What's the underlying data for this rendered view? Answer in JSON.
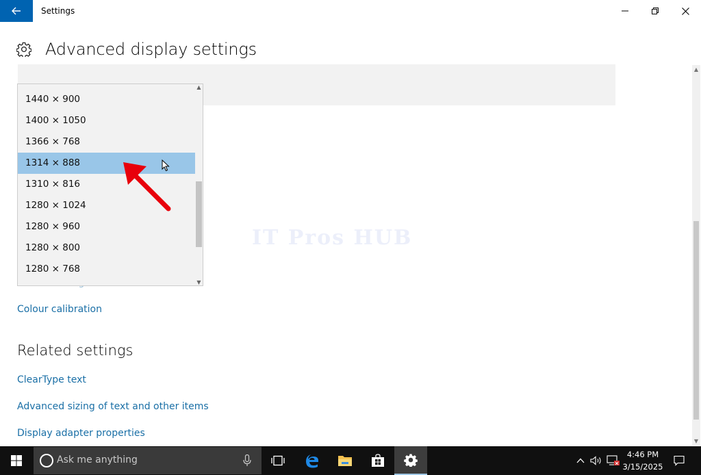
{
  "window": {
    "title": "Settings",
    "icons": {
      "back": "back-arrow-icon",
      "minimize": "minimize-icon",
      "maximize": "restore-icon",
      "close": "close-icon"
    }
  },
  "page": {
    "title": "Advanced display settings",
    "icon": "gear-icon"
  },
  "resolution_dropdown": {
    "options": [
      "1440 × 900",
      "1400 × 1050",
      "1366 × 768",
      "1314 × 888",
      "1310 × 816",
      "1280 × 1024",
      "1280 × 960",
      "1280 × 800",
      "1280 × 768"
    ],
    "selected": "1314 × 888",
    "highlight_color": "#99c6e8"
  },
  "links": {
    "colour_management": "Colour management",
    "colour_calibration": "Colour calibration"
  },
  "related_settings": {
    "title": "Related settings",
    "items": [
      "ClearType text",
      "Advanced sizing of text and other items",
      "Display adapter properties"
    ]
  },
  "watermark": "IT Pros HUB",
  "annotation": {
    "arrow_color": "#e8000b"
  },
  "taskbar": {
    "search_placeholder": "Ask me anything",
    "time": "4:46 PM",
    "date": "3/15/2025",
    "icons": [
      "windows-start-icon",
      "cortana-icon",
      "microphone-icon",
      "task-view-icon",
      "edge-icon",
      "file-explorer-icon",
      "store-icon",
      "settings-icon",
      "chevron-up-icon",
      "volume-icon",
      "network-icon",
      "notification-icon"
    ]
  },
  "colors": {
    "accent": "#0063b1",
    "link": "#1a6fa6",
    "taskbar": "#101010"
  }
}
